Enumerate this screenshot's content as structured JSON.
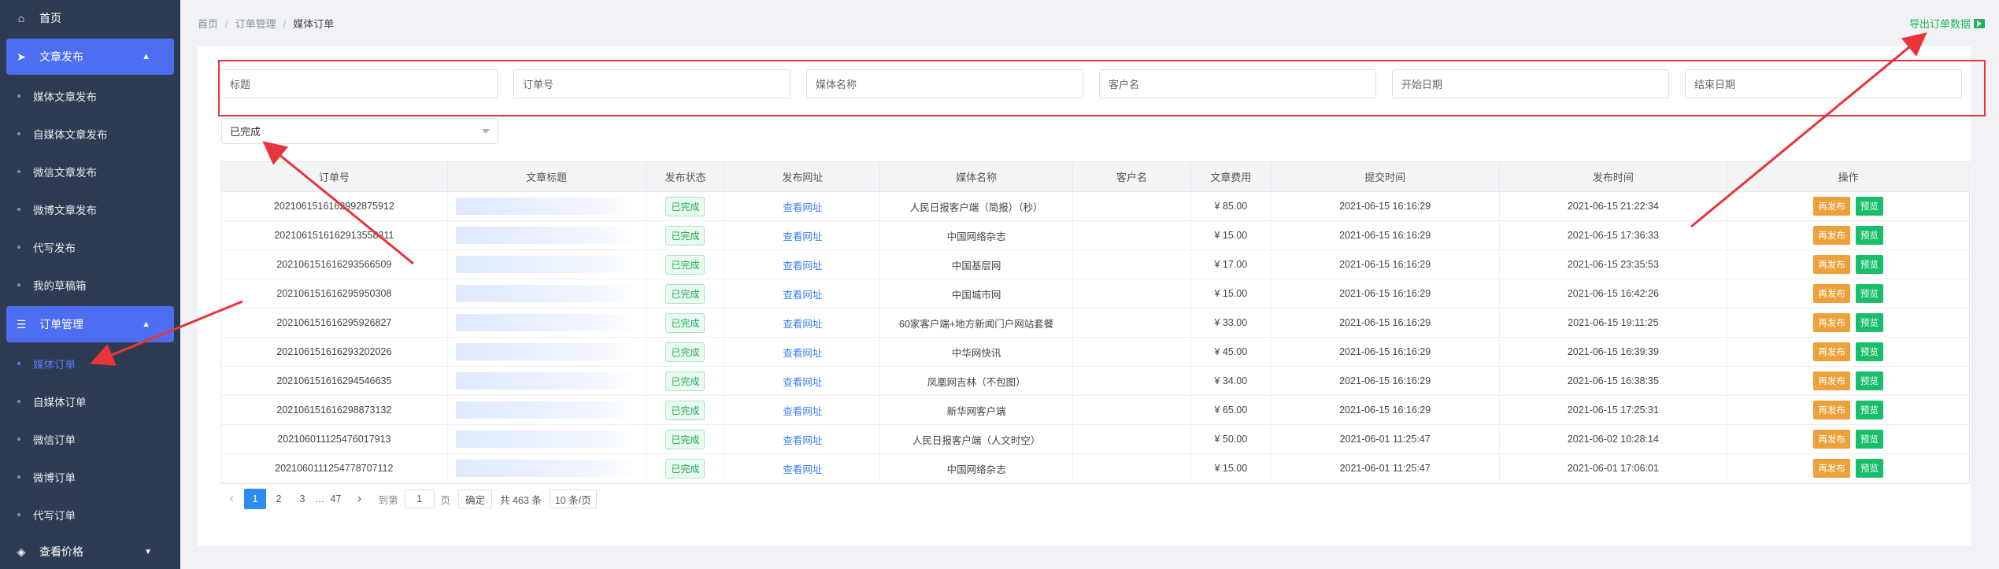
{
  "sidebar": {
    "home": "首页",
    "article_publish": "文章发布",
    "items_a": [
      "媒体文章发布",
      "自媒体文章发布",
      "微信文章发布",
      "微博文章发布",
      "代写发布",
      "我的草稿箱"
    ],
    "order_manage": "订单管理",
    "items_b": [
      "媒体订单",
      "自媒体订单",
      "微信订单",
      "微博订单",
      "代写订单"
    ],
    "price": "查看价格"
  },
  "breadcrumb": {
    "home": "首页",
    "sep": "/",
    "parent": "订单管理",
    "current": "媒体订单"
  },
  "export_label": "导出订单数据",
  "filters": {
    "title": "标题",
    "order_no": "订单号",
    "media_name": "媒体名称",
    "customer": "客户名",
    "start_date": "开始日期",
    "end_date": "结束日期"
  },
  "status_select": "已完成",
  "table": {
    "headers": [
      "订单号",
      "文章标题",
      "发布状态",
      "发布网址",
      "媒体名称",
      "客户名",
      "文章费用",
      "提交时间",
      "发布时间",
      "操作"
    ],
    "status_label": "已完成",
    "link_label": "查看网址",
    "republish_label": "再发布",
    "preview_label": "预览",
    "rows": [
      {
        "order": "20210615161629928759­12",
        "media": "人民日报客户端（简报）（秒）",
        "fee": "¥ 85.00",
        "submit": "2021-06-15 16:16:29",
        "publish": "2021-06-15 21:22:34"
      },
      {
        "order": "202106151616291355­8311",
        "media": "中国网络杂志",
        "fee": "¥ 15.00",
        "submit": "2021-06-15 16:16:29",
        "publish": "2021-06-15 17:36:33"
      },
      {
        "order": "202106151616293566509",
        "media": "中国基层网",
        "fee": "¥ 17.00",
        "submit": "2021-06-15 16:16:29",
        "publish": "2021-06-15 23:35:53"
      },
      {
        "order": "202106151616295950308",
        "media": "中国城市网",
        "fee": "¥ 15.00",
        "submit": "2021-06-15 16:16:29",
        "publish": "2021-06-15 16:42:26"
      },
      {
        "order": "202106151616295926827",
        "media": "60家客户端+地方新闻门户网站套餐",
        "fee": "¥ 33.00",
        "submit": "2021-06-15 16:16:29",
        "publish": "2021-06-15 19:11:25"
      },
      {
        "order": "202106151616293202026",
        "media": "中华网快讯",
        "fee": "¥ 45.00",
        "submit": "2021-06-15 16:16:29",
        "publish": "2021-06-15 16:39:39"
      },
      {
        "order": "202106151616294546635",
        "media": "凤凰网吉林（不包图）",
        "fee": "¥ 34.00",
        "submit": "2021-06-15 16:16:29",
        "publish": "2021-06-15 16:38:35"
      },
      {
        "order": "202106151616298873132",
        "media": "新华网客户端",
        "fee": "¥ 65.00",
        "submit": "2021-06-15 16:16:29",
        "publish": "2021-06-15 17:25:31"
      },
      {
        "order": "202106011125476017913",
        "media": "人民日报客户端（人文时空）",
        "fee": "¥ 50.00",
        "submit": "2021-06-01 11:25:47",
        "publish": "2021-06-02 10:28:14"
      },
      {
        "order": "202106011125477870711­2",
        "media": "中国网络杂志",
        "fee": "¥ 15.00",
        "submit": "2021-06-01 11:25:47",
        "publish": "2021-06-01 17:06:01"
      }
    ]
  },
  "pager": {
    "p1": "1",
    "p2": "2",
    "p3": "3",
    "ellipsis": "…",
    "last": "47",
    "goto": "到第",
    "goto_value": "1",
    "page_unit": "页",
    "confirm": "确定",
    "total": "共 463 条",
    "size": "10 条/页"
  },
  "colors": {
    "accent": "#4e6ef2",
    "sidebar": "#2f3b52",
    "green": "#19be6b",
    "orange": "#eea13a",
    "annotation": "#e8343a"
  }
}
